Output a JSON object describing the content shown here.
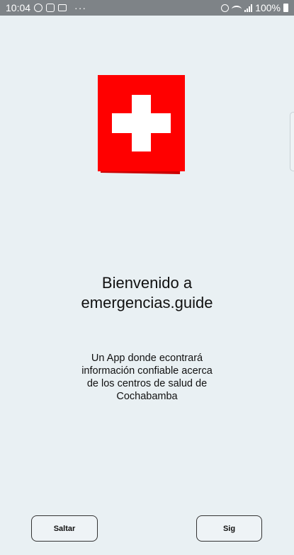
{
  "status_bar": {
    "time": "10:04",
    "more": "···",
    "battery_text": "100%"
  },
  "logo": {
    "icon": "red-cross-icon",
    "red": "#ee0000",
    "white": "#ffffff"
  },
  "welcome": {
    "title_lines": [
      "Bienvenido a",
      "emergencias.guide"
    ],
    "description_lines": [
      "Un App donde econtrará",
      "información confiable acerca",
      "de los centros de salud de",
      "Cochabamba"
    ]
  },
  "buttons": {
    "skip": "Saltar",
    "next": "Sig"
  },
  "colors": {
    "background": "#e9f0f3",
    "status_bar": "#7e8387"
  }
}
